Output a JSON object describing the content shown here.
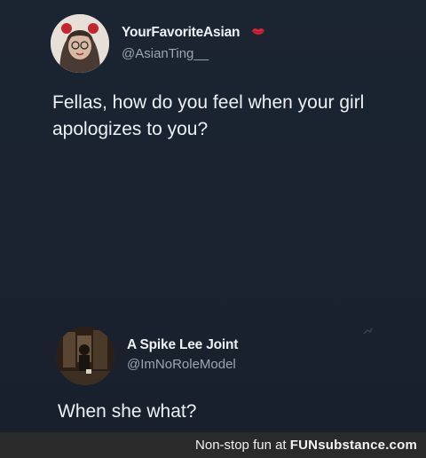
{
  "tweets": [
    {
      "display_name": "YourFavoriteAsian",
      "handle": "@AsianTing__",
      "badge_icon": "lips-icon",
      "text": "Fellas, how do you feel when your girl apologizes to you?"
    },
    {
      "display_name": "A Spike Lee Joint",
      "handle": "@ImNoRoleModel",
      "text": "When she what?"
    }
  ],
  "footer": {
    "tagline": "Non-stop fun at",
    "brand": "FUNsubstance.com"
  },
  "colors": {
    "background": "#1b2431",
    "text": "#eef1f4",
    "handle": "#9aa6b3",
    "badge_red": "#e0243a",
    "footer_bg": "#2a2a2a"
  }
}
